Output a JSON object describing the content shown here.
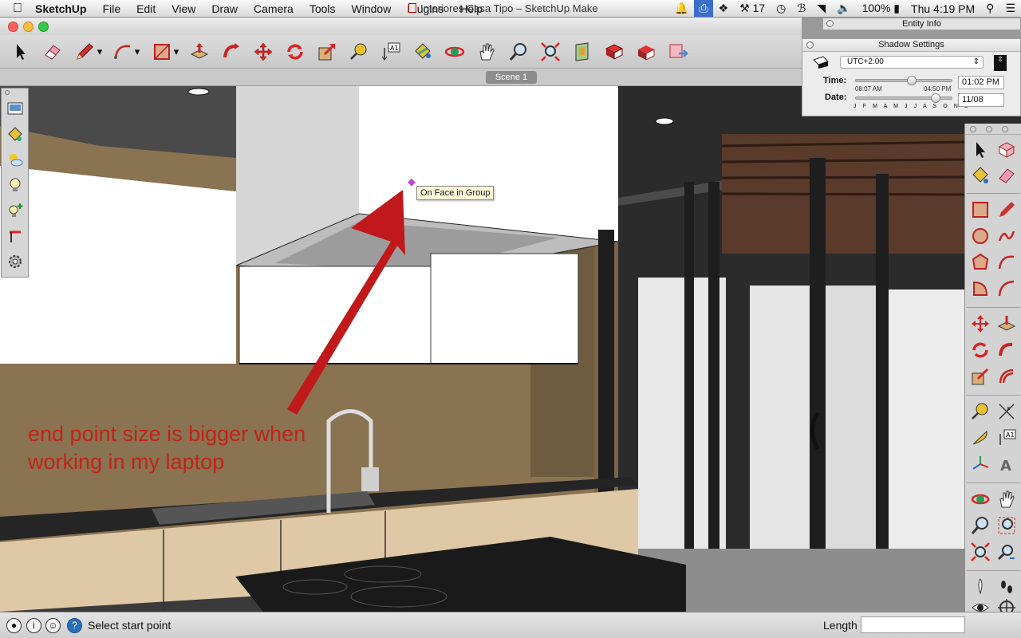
{
  "menubar": {
    "apple_icon": "apple-icon",
    "app_name": "SketchUp",
    "menus": [
      "File",
      "Edit",
      "View",
      "Draw",
      "Camera",
      "Tools",
      "Window",
      "Plugins",
      "Help"
    ],
    "status": {
      "badge_count": "17",
      "battery": "100%",
      "clock": "Thu 4:19 PM"
    }
  },
  "window": {
    "title": "Interiores Casa Tipo – SketchUp Make"
  },
  "toolbar": {
    "tools": [
      "select",
      "eraser",
      "pencil",
      "arc",
      "rectangle",
      "push-pull",
      "follow-me",
      "move",
      "rotate",
      "scale",
      "tape-measure",
      "text",
      "paint-bucket",
      "orbit",
      "pan",
      "zoom",
      "zoom-extents",
      "section-plane",
      "components",
      "warehouse",
      "send-to-layout"
    ]
  },
  "scene_tab": "Scene 1",
  "viewport": {
    "inference_tooltip": "On Face in Group",
    "annotation_line1": "end point size is bigger when",
    "annotation_line2": "working in my laptop"
  },
  "entity_info": {
    "title": "Entity Info"
  },
  "shadow_settings": {
    "title": "Shadow Settings",
    "timezone": "UTC+2:00",
    "time_label": "Time:",
    "time_min": "08:07 AM",
    "time_max": "04:50 PM",
    "time_value": "01:02 PM",
    "time_slider_fraction": 0.58,
    "date_label": "Date:",
    "date_value": "11/08",
    "date_slider_fraction": 0.83,
    "months": "J F M A M J J A S O N D"
  },
  "statusbar": {
    "help_icon": "?",
    "message": "Select start point",
    "length_label": "Length",
    "length_value": ""
  },
  "colors": {
    "annotation_red": "#c0231c",
    "arrow_red": "#c0181b",
    "wall_tan": "#8a7351",
    "wood_cabinet": "#dec8a5",
    "dark_structure": "#2b2b2b"
  }
}
